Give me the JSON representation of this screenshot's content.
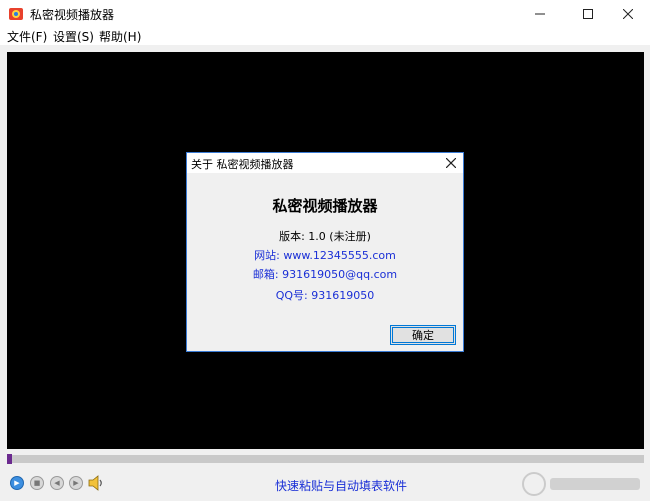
{
  "window": {
    "title": "私密视频播放器",
    "icon": "app-logo-icon",
    "controls": [
      "minimize-icon",
      "maximize-icon",
      "close-icon"
    ]
  },
  "menu": [
    {
      "label": "文件(F)"
    },
    {
      "label": "设置(S)"
    },
    {
      "label": "帮助(H)"
    }
  ],
  "about_dialog": {
    "title": "关于 私密视频播放器",
    "app_name": "私密视频播放器",
    "version": "版本: 1.0 (未注册)",
    "website": "网站: www.12345555.com",
    "email": "邮箱: 931619050@qq.com",
    "qq": "QQ号: 931619050",
    "ok_label": "确定"
  },
  "player": {
    "progress": 0.0,
    "controls": [
      "play-icon",
      "stop-icon",
      "previous-icon",
      "next-icon",
      "volume-icon"
    ],
    "promo_link": "快速粘贴与自动填表软件"
  },
  "colors": {
    "video_bg": "#000000",
    "link": "#1a2fd6",
    "accent": "#0078d7",
    "progress_thumb": "#6b2a8f"
  }
}
